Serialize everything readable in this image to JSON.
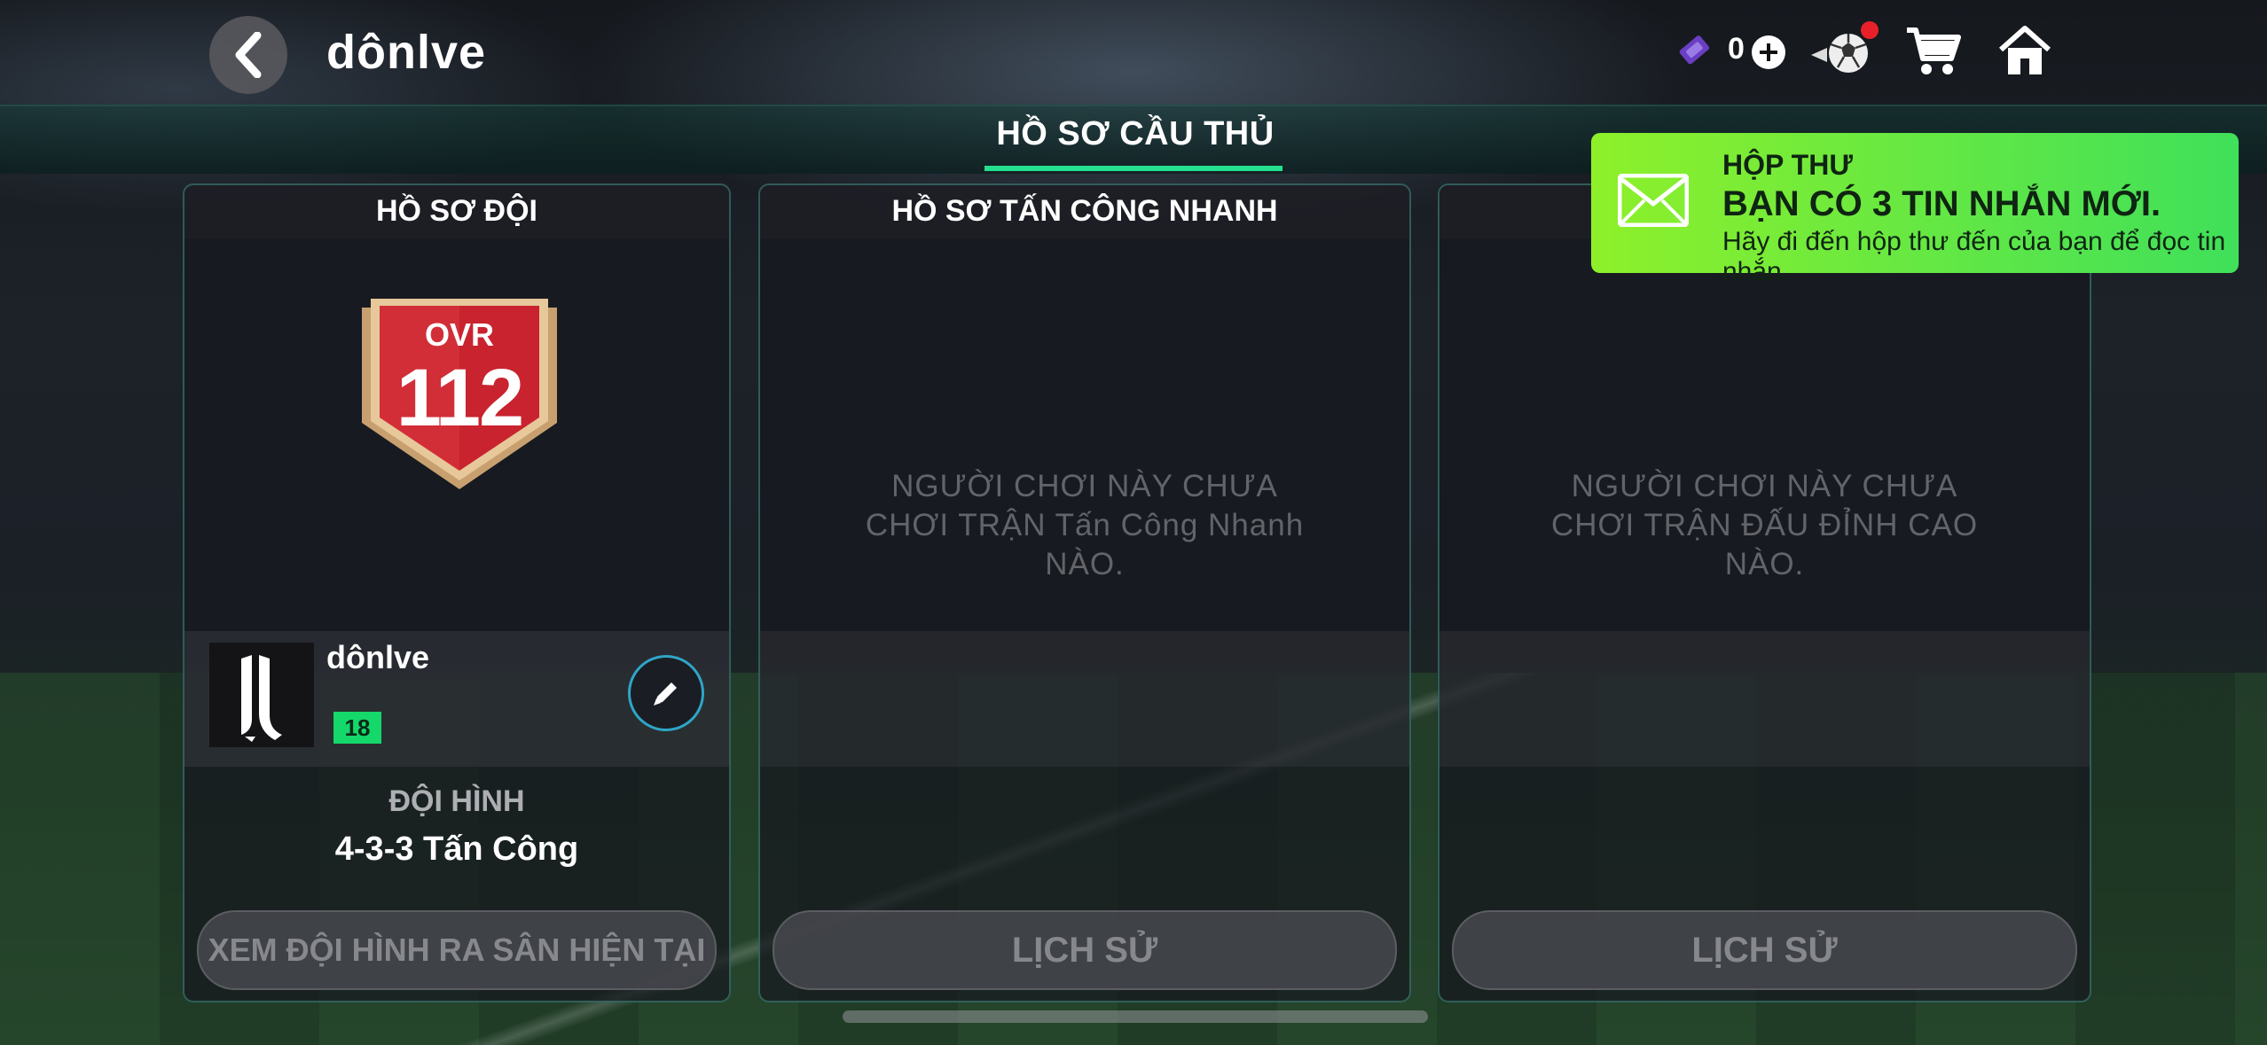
{
  "topbar": {
    "title": "dônlve",
    "ticket_count": "0",
    "icons": [
      "back-chevron-icon",
      "ticket-icon",
      "plus-icon",
      "football-icon",
      "cart-icon",
      "home-icon"
    ]
  },
  "header": {
    "title": "HỒ SƠ CẦU THỦ"
  },
  "panels": {
    "team": {
      "title": "HỒ SƠ ĐỘI",
      "ovr_label": "OVR",
      "ovr_value": "112",
      "team_name": "dônlve",
      "level": "18",
      "formation_label": "ĐỘI HÌNH",
      "formation_value": "4-3-3 Tấn Công",
      "button_label": "XEM ĐỘI HÌNH RA SÂN HIỆN TẠI"
    },
    "quick_attack": {
      "title": "HỒ SƠ TẤN CÔNG NHANH",
      "empty_line1": "NGƯỜI CHƠI NÀY CHƯA",
      "empty_line2": "CHƠI TRẬN Tấn Công Nhanh",
      "empty_line3": "NÀO.",
      "button_label": "LỊCH SỬ"
    },
    "top_match": {
      "empty_line1": "NGƯỜI CHƠI NÀY CHƯA",
      "empty_line2": "CHƠI TRẬN ĐẤU ĐỈNH CAO",
      "empty_line3": "NÀO.",
      "button_label": "LỊCH SỬ"
    }
  },
  "toast": {
    "title": "HỘP THƯ",
    "headline": "BẠN CÓ 3 TIN NHẮN MỚI.",
    "subtext": "Hãy đi đến hộp thư đến của bạn để đọc tin nhắn."
  },
  "colors": {
    "accent_green": "#25e08e",
    "badge_red": "#c8232f",
    "level_green": "#14d86a",
    "toast_green": "#8ef02a",
    "notification_red": "#e8202a",
    "edit_ring": "#2ea6c8"
  }
}
